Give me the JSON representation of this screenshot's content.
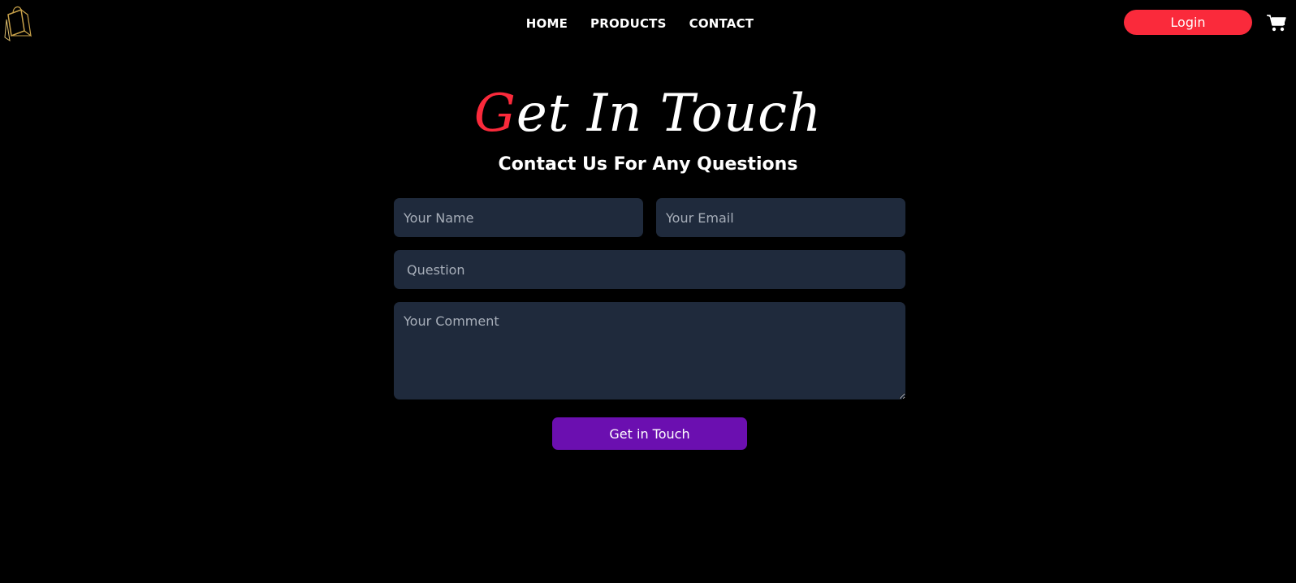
{
  "nav": {
    "items": [
      {
        "label": "HOME"
      },
      {
        "label": "PRODUCTS"
      },
      {
        "label": "CONTACT"
      }
    ]
  },
  "header": {
    "login_label": "Login",
    "cart_icon": "shopping-cart-icon",
    "logo_icon": "shopping-bag-logo-icon"
  },
  "hero": {
    "title_first_letter": "G",
    "title_rest": "et In Touch",
    "subtitle": "Contact Us For Any Questions"
  },
  "form": {
    "name_placeholder": "Your Name",
    "email_placeholder": "Your Email",
    "question_placeholder": "Question",
    "comment_placeholder": "Your Comment",
    "submit_label": "Get in Touch"
  },
  "colors": {
    "background": "#000000",
    "accent_red": "#fa2a3b",
    "field_bg": "#1f2a3c",
    "submit_purple": "#6b0fb0",
    "logo_gold": "#c9a24a"
  }
}
